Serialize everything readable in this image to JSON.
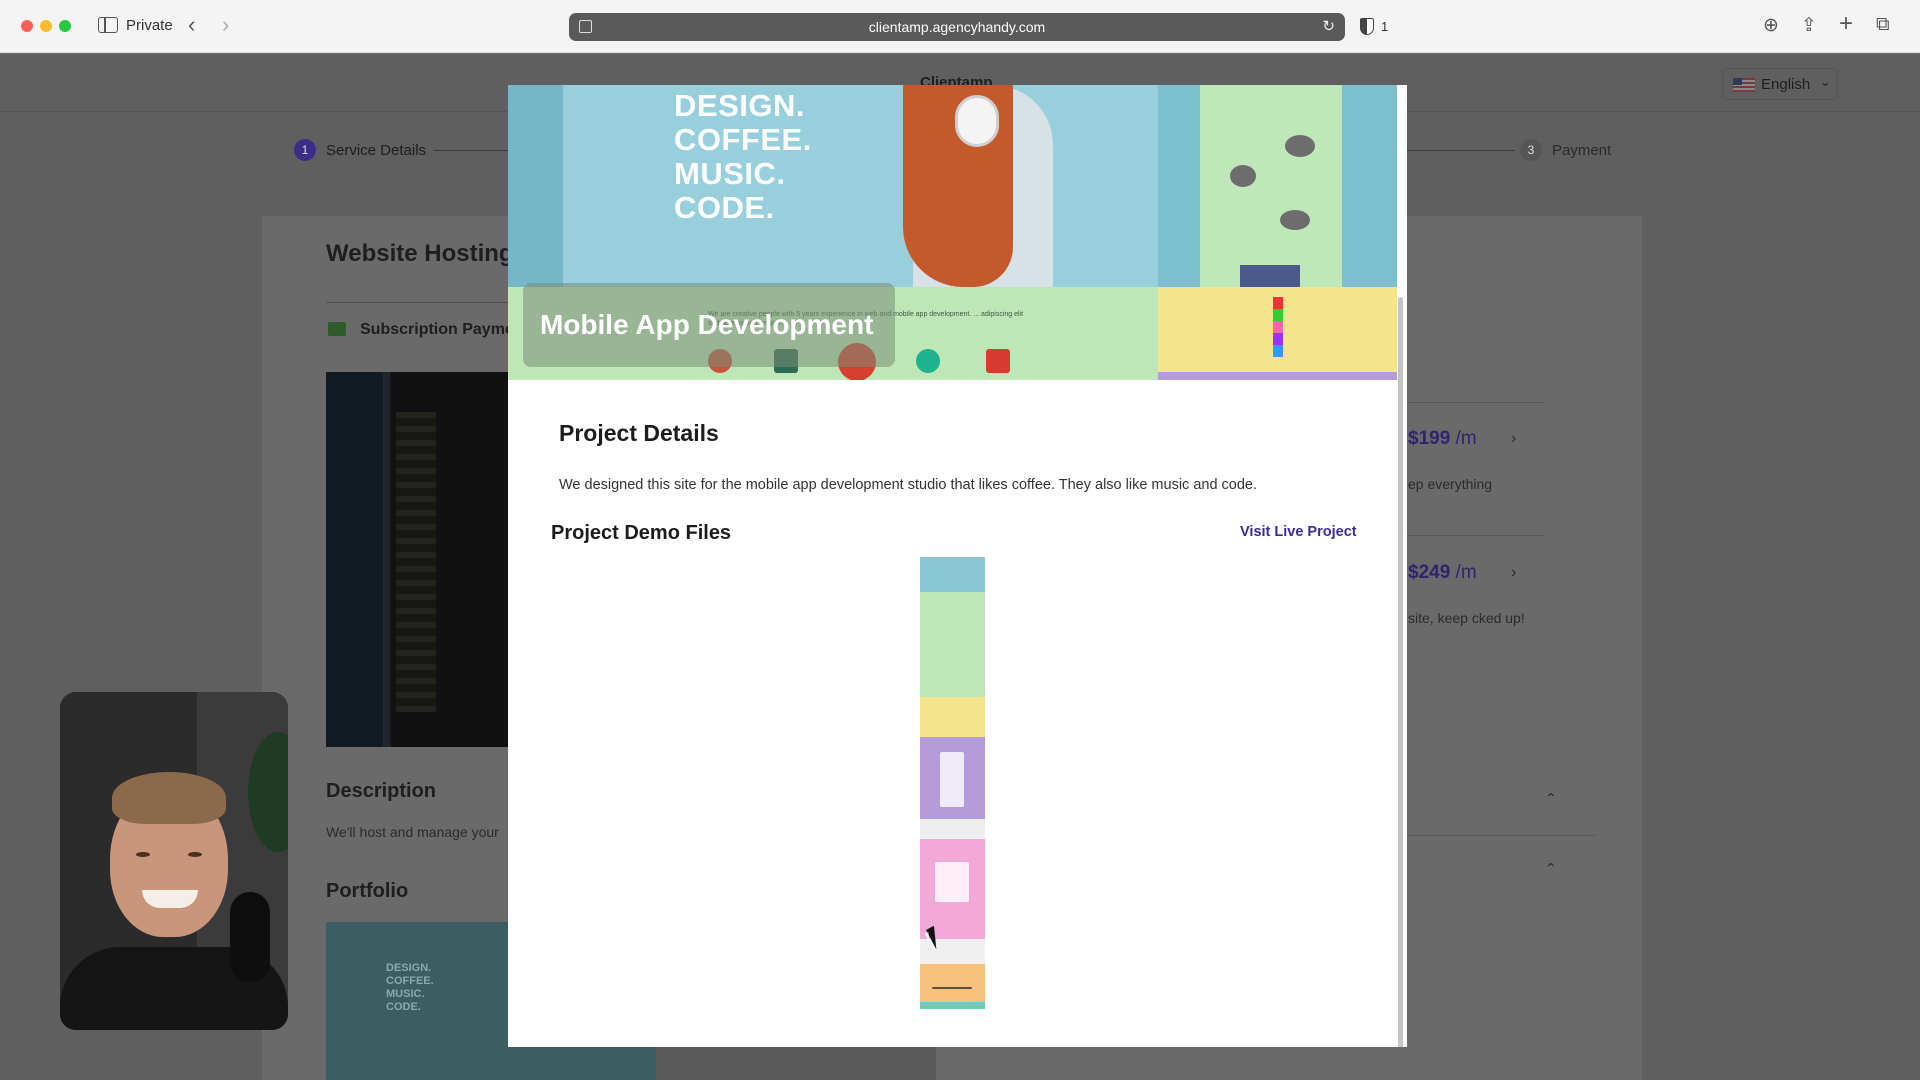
{
  "browser": {
    "private_label": "Private",
    "url": "clientamp.agencyhandy.com",
    "shield_count": "1",
    "icons": [
      "sidebar-icon",
      "back-icon",
      "forward-icon",
      "reload-icon",
      "shield-icon",
      "download-icon",
      "share-icon",
      "new-tab-icon",
      "tabs-overview-icon"
    ]
  },
  "background_page": {
    "brand": "Clientamp",
    "language": "English",
    "steps": [
      {
        "number": "1",
        "label": "Service Details",
        "active": true
      },
      {
        "number": "3",
        "label": "Payment",
        "active": false
      }
    ],
    "service_title": "Website Hosting",
    "subscription_label": "Subscription Payme",
    "description_heading": "Description",
    "description_text": "We'll host and manage your",
    "portfolio_heading": "Portfolio",
    "portfolio_thumb_text": "DESIGN.\nCOFFEE.\nMUSIC.\nCODE.",
    "plans": [
      {
        "price": "$199",
        "per": " /m",
        "text": "ep everything"
      },
      {
        "price": "$249",
        "per": " /m",
        "text": "site, keep cked up!"
      }
    ],
    "accent_color": "#4b3bb0"
  },
  "modal": {
    "hero_text_lines": [
      "DESIGN.",
      "COFFEE.",
      "MUSIC.",
      "CODE."
    ],
    "hero_small_text": "We are creative people with 5 years experience in web and mobile app development. ... adipiscing elit sed do eiusmod tempor.",
    "hero_title": "Mobile App Development",
    "project_details_heading": "Project Details",
    "project_details_text": "We designed this site for the mobile app development studio that likes coffee. They also like music and code.",
    "demo_files_heading": "Project Demo Files",
    "visit_live_label": "Visit Live Project",
    "link_color": "#3a2a9a"
  }
}
